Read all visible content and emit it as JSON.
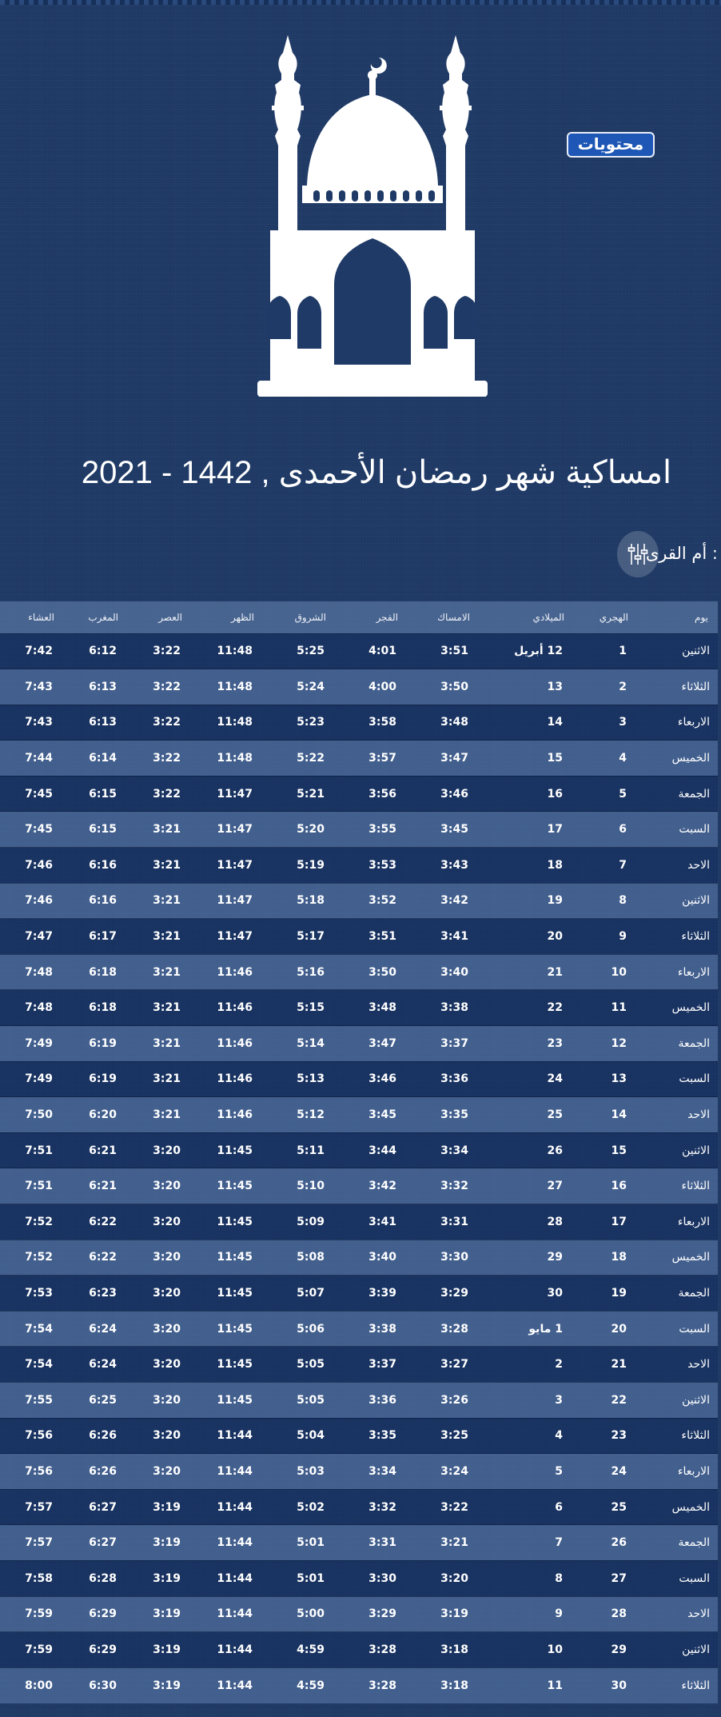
{
  "badge": "محتويات",
  "title": "امساكية شهر رمضان الأحمدى , 1442 - 2021",
  "source_label": ": أم القرى",
  "columns": [
    "يوم",
    "الهجري",
    "الميلادي",
    "الامساك",
    "الفجر",
    "الشروق",
    "الظهر",
    "العصر",
    "المغرب",
    "العشاء"
  ],
  "rows": [
    [
      "الاثنين",
      "1",
      "12 أبريل",
      "3:51",
      "4:01",
      "5:25",
      "11:48",
      "3:22",
      "6:12",
      "7:42"
    ],
    [
      "الثلاثاء",
      "2",
      "13",
      "3:50",
      "4:00",
      "5:24",
      "11:48",
      "3:22",
      "6:13",
      "7:43"
    ],
    [
      "الاربعاء",
      "3",
      "14",
      "3:48",
      "3:58",
      "5:23",
      "11:48",
      "3:22",
      "6:13",
      "7:43"
    ],
    [
      "الخميس",
      "4",
      "15",
      "3:47",
      "3:57",
      "5:22",
      "11:48",
      "3:22",
      "6:14",
      "7:44"
    ],
    [
      "الجمعة",
      "5",
      "16",
      "3:46",
      "3:56",
      "5:21",
      "11:47",
      "3:22",
      "6:15",
      "7:45"
    ],
    [
      "السبت",
      "6",
      "17",
      "3:45",
      "3:55",
      "5:20",
      "11:47",
      "3:21",
      "6:15",
      "7:45"
    ],
    [
      "الاحد",
      "7",
      "18",
      "3:43",
      "3:53",
      "5:19",
      "11:47",
      "3:21",
      "6:16",
      "7:46"
    ],
    [
      "الاثنين",
      "8",
      "19",
      "3:42",
      "3:52",
      "5:18",
      "11:47",
      "3:21",
      "6:16",
      "7:46"
    ],
    [
      "الثلاثاء",
      "9",
      "20",
      "3:41",
      "3:51",
      "5:17",
      "11:47",
      "3:21",
      "6:17",
      "7:47"
    ],
    [
      "الاربعاء",
      "10",
      "21",
      "3:40",
      "3:50",
      "5:16",
      "11:46",
      "3:21",
      "6:18",
      "7:48"
    ],
    [
      "الخميس",
      "11",
      "22",
      "3:38",
      "3:48",
      "5:15",
      "11:46",
      "3:21",
      "6:18",
      "7:48"
    ],
    [
      "الجمعة",
      "12",
      "23",
      "3:37",
      "3:47",
      "5:14",
      "11:46",
      "3:21",
      "6:19",
      "7:49"
    ],
    [
      "السبت",
      "13",
      "24",
      "3:36",
      "3:46",
      "5:13",
      "11:46",
      "3:21",
      "6:19",
      "7:49"
    ],
    [
      "الاحد",
      "14",
      "25",
      "3:35",
      "3:45",
      "5:12",
      "11:46",
      "3:21",
      "6:20",
      "7:50"
    ],
    [
      "الاثنين",
      "15",
      "26",
      "3:34",
      "3:44",
      "5:11",
      "11:45",
      "3:20",
      "6:21",
      "7:51"
    ],
    [
      "الثلاثاء",
      "16",
      "27",
      "3:32",
      "3:42",
      "5:10",
      "11:45",
      "3:20",
      "6:21",
      "7:51"
    ],
    [
      "الاربعاء",
      "17",
      "28",
      "3:31",
      "3:41",
      "5:09",
      "11:45",
      "3:20",
      "6:22",
      "7:52"
    ],
    [
      "الخميس",
      "18",
      "29",
      "3:30",
      "3:40",
      "5:08",
      "11:45",
      "3:20",
      "6:22",
      "7:52"
    ],
    [
      "الجمعة",
      "19",
      "30",
      "3:29",
      "3:39",
      "5:07",
      "11:45",
      "3:20",
      "6:23",
      "7:53"
    ],
    [
      "السبت",
      "20",
      "1 مايو",
      "3:28",
      "3:38",
      "5:06",
      "11:45",
      "3:20",
      "6:24",
      "7:54"
    ],
    [
      "الاحد",
      "21",
      "2",
      "3:27",
      "3:37",
      "5:05",
      "11:45",
      "3:20",
      "6:24",
      "7:54"
    ],
    [
      "الاثنين",
      "22",
      "3",
      "3:26",
      "3:36",
      "5:05",
      "11:45",
      "3:20",
      "6:25",
      "7:55"
    ],
    [
      "الثلاثاء",
      "23",
      "4",
      "3:25",
      "3:35",
      "5:04",
      "11:44",
      "3:20",
      "6:26",
      "7:56"
    ],
    [
      "الاربعاء",
      "24",
      "5",
      "3:24",
      "3:34",
      "5:03",
      "11:44",
      "3:20",
      "6:26",
      "7:56"
    ],
    [
      "الخميس",
      "25",
      "6",
      "3:22",
      "3:32",
      "5:02",
      "11:44",
      "3:19",
      "6:27",
      "7:57"
    ],
    [
      "الجمعة",
      "26",
      "7",
      "3:21",
      "3:31",
      "5:01",
      "11:44",
      "3:19",
      "6:27",
      "7:57"
    ],
    [
      "السبت",
      "27",
      "8",
      "3:20",
      "3:30",
      "5:01",
      "11:44",
      "3:19",
      "6:28",
      "7:58"
    ],
    [
      "الاحد",
      "28",
      "9",
      "3:19",
      "3:29",
      "5:00",
      "11:44",
      "3:19",
      "6:29",
      "7:59"
    ],
    [
      "الاثنين",
      "29",
      "10",
      "3:18",
      "3:28",
      "4:59",
      "11:44",
      "3:19",
      "6:29",
      "7:59"
    ],
    [
      "الثلاثاء",
      "30",
      "11",
      "3:18",
      "3:28",
      "4:59",
      "11:44",
      "3:19",
      "6:30",
      "8:00"
    ]
  ]
}
